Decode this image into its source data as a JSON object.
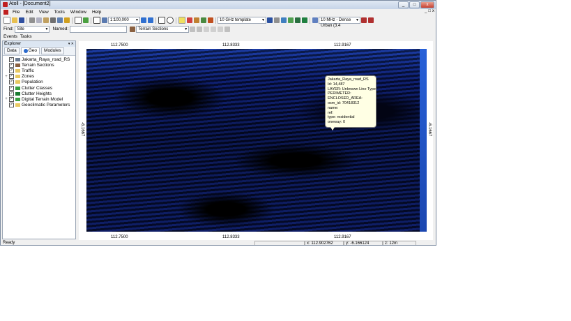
{
  "window": {
    "title": "Atoll - [Document2]",
    "minimize": "_",
    "maximize": "□",
    "close": "x"
  },
  "menu": [
    "File",
    "Edit",
    "View",
    "Tools",
    "Window",
    "Help"
  ],
  "toolbar": {
    "scale": "1:100,000",
    "template": "10 GHz template",
    "clutter_class": "10 MHz - Dense Urban (3.4"
  },
  "find": {
    "label": "Find:",
    "value": "Site",
    "named_label": "Named:",
    "named_value": "",
    "terrain_sections": "Terrain Sections"
  },
  "tabs": [
    "Events",
    "Tasks"
  ],
  "explorer": {
    "title": "Explorer",
    "tabs": [
      "Data",
      "Geo",
      "Modules"
    ],
    "items": [
      {
        "label": "Jakarta_Raya_road_RS",
        "expander": "",
        "checked": "✓",
        "color": "#6a7a90"
      },
      {
        "label": "Terrain Sections",
        "expander": "",
        "checked": "✓",
        "color": "#8a6040"
      },
      {
        "label": "Traffic",
        "expander": "",
        "checked": "✓",
        "color": "#e8c860"
      },
      {
        "label": "Zones",
        "expander": "+",
        "checked": "✓",
        "color": "#e8c860"
      },
      {
        "label": "Population",
        "expander": "",
        "checked": "✓",
        "color": "#e8c860"
      },
      {
        "label": "Clutter Classes",
        "expander": "",
        "checked": "✓",
        "color": "#3aa040"
      },
      {
        "label": "Clutter Heights",
        "expander": "",
        "checked": "✓",
        "color": "#1a7a30"
      },
      {
        "label": "Digital Terrain Model",
        "expander": "+",
        "checked": "✓",
        "color": "#3aa040"
      },
      {
        "label": "Geoclimatic Parameters",
        "expander": "",
        "checked": "✓",
        "color": "#e8c860"
      }
    ]
  },
  "map": {
    "x_ticks": [
      "112.7500",
      "112.8333",
      "112.9167"
    ],
    "y_label": "-6.1667",
    "tooltip": [
      "Jakarta_Raya_road_RS",
      "Id: 14,487",
      "LAYER: Unknown Line Type",
      "PERIMETER:",
      "ENCLOSED_AREA:",
      "osm_id: 70418312",
      "name:",
      "ref:",
      "type: residential",
      "oneway: 0"
    ]
  },
  "status": {
    "text": "Ready",
    "x": "x: 112.902762",
    "y": "y: -6.166124",
    "z": "z: 12m"
  },
  "colors": {
    "map_top": "#1b3fa8",
    "map_dark": "#06103e",
    "tooltip_bg": "#ffffe4"
  }
}
